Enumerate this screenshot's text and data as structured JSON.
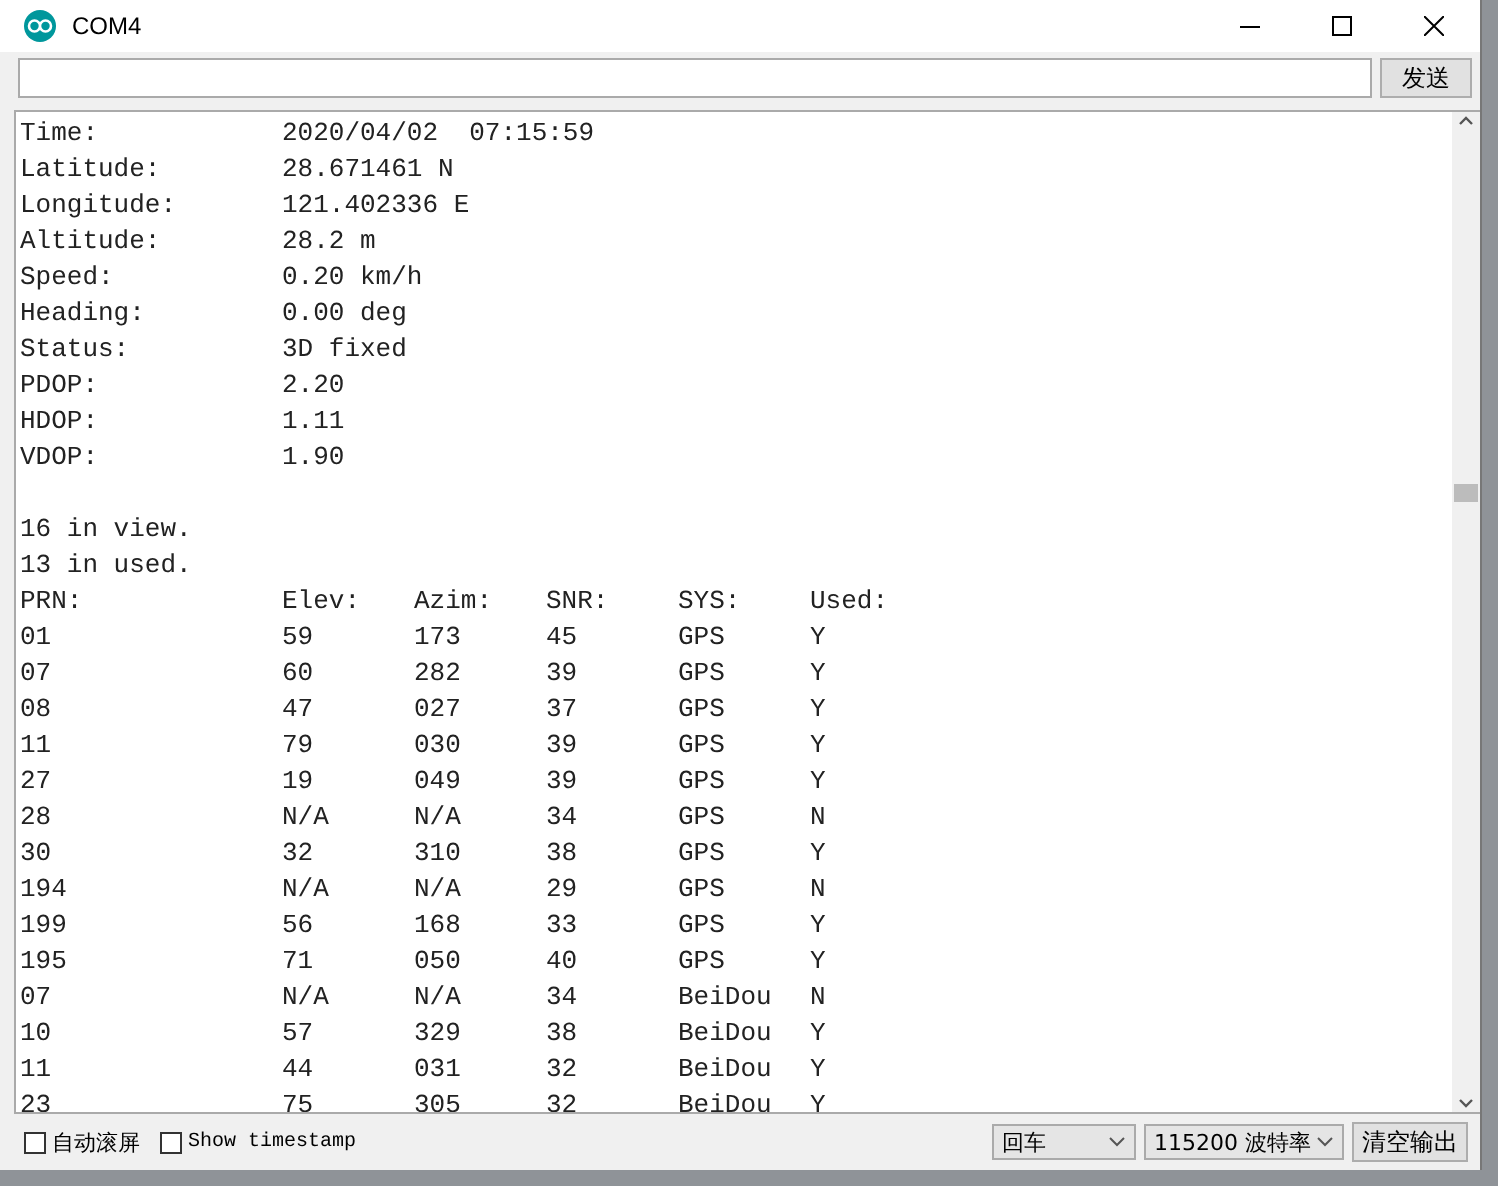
{
  "window": {
    "title": "COM4"
  },
  "send": {
    "button": "发送"
  },
  "output": {
    "fields": [
      {
        "label": "Time:",
        "value": "2020/04/02  07:15:59"
      },
      {
        "label": "Latitude:",
        "value": "28.671461 N"
      },
      {
        "label": "Longitude:",
        "value": "121.402336 E"
      },
      {
        "label": "Altitude:",
        "value": "28.2 m"
      },
      {
        "label": "Speed:",
        "value": "0.20 km/h"
      },
      {
        "label": "Heading:",
        "value": "0.00 deg"
      },
      {
        "label": "Status:",
        "value": "3D fixed"
      },
      {
        "label": "PDOP:",
        "value": "2.20"
      },
      {
        "label": "HDOP:",
        "value": "1.11"
      },
      {
        "label": "VDOP:",
        "value": "1.90"
      }
    ],
    "summary": [
      "16 in view.",
      "13 in used."
    ],
    "table": {
      "columns": [
        "PRN:",
        "Elev:",
        "Azim:",
        "SNR:",
        "SYS:",
        "Used:"
      ],
      "rows": [
        [
          "01",
          "59",
          "173",
          "45",
          "GPS",
          "Y"
        ],
        [
          "07",
          "60",
          "282",
          "39",
          "GPS",
          "Y"
        ],
        [
          "08",
          "47",
          "027",
          "37",
          "GPS",
          "Y"
        ],
        [
          "11",
          "79",
          "030",
          "39",
          "GPS",
          "Y"
        ],
        [
          "27",
          "19",
          "049",
          "39",
          "GPS",
          "Y"
        ],
        [
          "28",
          "N/A",
          "N/A",
          "34",
          "GPS",
          "N"
        ],
        [
          "30",
          "32",
          "310",
          "38",
          "GPS",
          "Y"
        ],
        [
          "194",
          "N/A",
          "N/A",
          "29",
          "GPS",
          "N"
        ],
        [
          "199",
          "56",
          "168",
          "33",
          "GPS",
          "Y"
        ],
        [
          "195",
          "71",
          "050",
          "40",
          "GPS",
          "Y"
        ],
        [
          "07",
          "N/A",
          "N/A",
          "34",
          "BeiDou",
          "N"
        ],
        [
          "10",
          "57",
          "329",
          "38",
          "BeiDou",
          "Y"
        ],
        [
          "11",
          "44",
          "031",
          "32",
          "BeiDou",
          "Y"
        ],
        [
          "23",
          "75",
          "305",
          "32",
          "BeiDou",
          "Y"
        ]
      ]
    }
  },
  "footer": {
    "autoscroll": {
      "label": "自动滚屏",
      "checked": false
    },
    "timestamp": {
      "label": "Show timestamp",
      "checked": false
    },
    "line_ending": "回车",
    "baud_rate": "115200 波特率",
    "clear_button": "清空输出"
  }
}
